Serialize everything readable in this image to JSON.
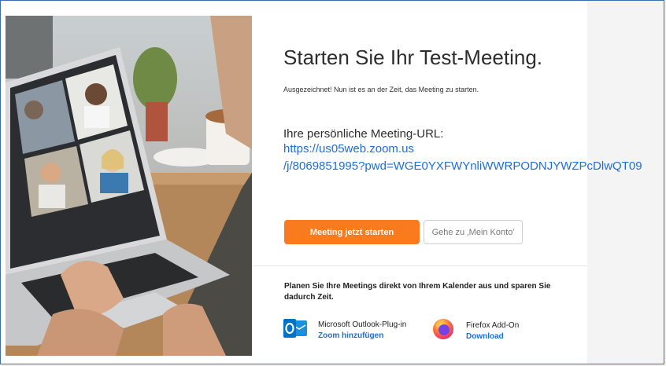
{
  "heading": "Starten Sie Ihr Test-Meeting.",
  "subtitle": "Ausgezeichnet! Nun ist es an der Zeit, das Meeting zu starten.",
  "url_label": "Ihre persönliche Meeting-URL:",
  "url_line1": "https://us05web.zoom.us",
  "url_line2": "/j/8069851995?pwd=WGE0YXFWYnliWWRPODNJYWZPcDlwQT09",
  "buttons": {
    "start": "Meeting jetzt starten",
    "account": "Gehe zu ‚Mein Konto'"
  },
  "calendar_text": "Planen Sie Ihre Meetings direkt von Ihrem Kalender aus und sparen Sie dadurch Zeit.",
  "plugins": [
    {
      "icon": "outlook-icon",
      "title": "Microsoft Outlook-Plug-in",
      "link": "Zoom hinzufügen",
      "color": "#0072c6"
    },
    {
      "icon": "firefox-icon",
      "title": "Firefox Add-On",
      "link": "Download",
      "color": "#ff7139"
    }
  ],
  "colors": {
    "accent": "#fa7a1e",
    "link": "#1d6fd8",
    "frame": "#3a6fb3"
  },
  "photo": "laptop-video-meeting-photo"
}
